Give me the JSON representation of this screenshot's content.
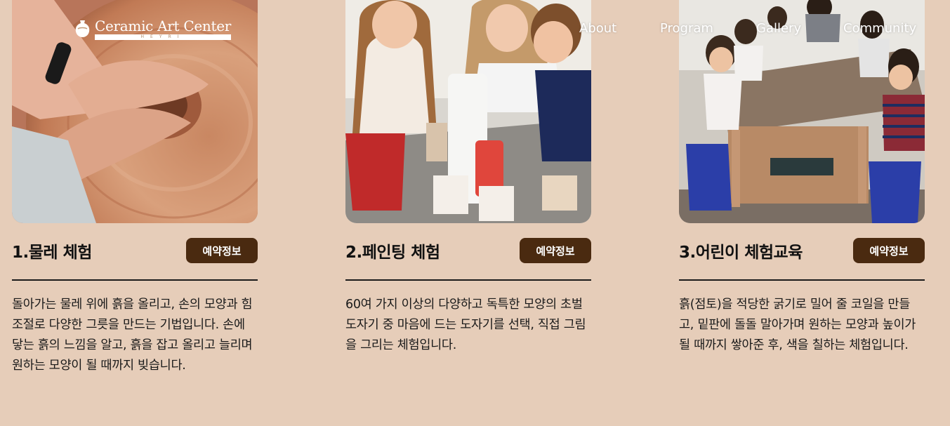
{
  "header": {
    "logo_name": "Ceramic Art Center",
    "logo_sub": "HEYRI",
    "nav": [
      "About",
      "Program",
      "Gallery",
      "Community"
    ]
  },
  "cards": [
    {
      "title": "1.물레 체험",
      "button": "예약정보",
      "desc": "돌아가는 물레 위에 흙을 올리고, 손의 모양과 힘 조절로 다양한 그릇을 만드는 기법입니다. 손에 닿는 흙의 느낌을 알고, 흙을 잡고 올리고 늘리며 원하는 모양이 될 때까지 빚습니다.",
      "image": "pottery-wheel-photo"
    },
    {
      "title": "2.페인팅 체험",
      "button": "예약정보",
      "desc": "60여 가지 이상의 다양하고 독특한 모양의 초벌 도자기 중 마음에 드는 도자기를 선택, 직접 그림을 그리는 체험입니다.",
      "image": "painting-class-photo"
    },
    {
      "title": "3.어린이 체험교육",
      "button": "예약정보",
      "desc": "흙(점토)을 적당한 굵기로 밀어 줄 코일을 만들고, 밑판에 돌돌 말아가며 원하는 모양과 높이가 될 때까지 쌓아준 후, 색을 칠하는 체험입니다.",
      "image": "kids-clay-class-photo"
    }
  ],
  "colors": {
    "background": "#e6cdb9",
    "button": "#4a2a10",
    "nav_text": "#ffffff"
  }
}
